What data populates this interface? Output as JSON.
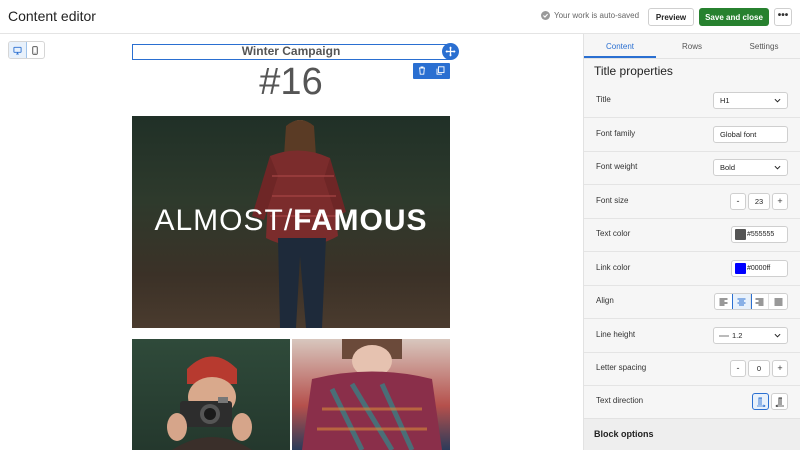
{
  "header": {
    "title": "Content editor",
    "autosave": "Your work is auto-saved",
    "preview_label": "Preview",
    "save_label": "Save and close",
    "more_label": "•••"
  },
  "canvas": {
    "title_text": "Winter Campaign",
    "headline": "#16",
    "hero_text_light": "ALMOST/",
    "hero_text_bold": "FAMOUS"
  },
  "panel": {
    "tabs": [
      "Content",
      "Rows",
      "Settings"
    ],
    "active_tab": "Content",
    "section_title": "Title properties",
    "fields": {
      "title": {
        "label": "Title",
        "value": "H1"
      },
      "font_family": {
        "label": "Font family",
        "value": "Global font"
      },
      "font_weight": {
        "label": "Font weight",
        "value": "Bold"
      },
      "font_size": {
        "label": "Font size",
        "value": "23",
        "minus": "-",
        "plus": "+"
      },
      "text_color": {
        "label": "Text color",
        "value": "#555555",
        "swatch": "#555555"
      },
      "link_color": {
        "label": "Link color",
        "value": "#0000ff",
        "swatch": "#0000ff"
      },
      "align": {
        "label": "Align",
        "active": "center"
      },
      "line_height": {
        "label": "Line height",
        "value": "1.2"
      },
      "letter_spacing": {
        "label": "Letter spacing",
        "value": "0",
        "minus": "-",
        "plus": "+"
      },
      "text_direction": {
        "label": "Text direction",
        "active": "ltr"
      }
    },
    "block_options": "Block options"
  },
  "colors": {
    "accent": "#2a6fd1",
    "save_green": "#27812f"
  }
}
